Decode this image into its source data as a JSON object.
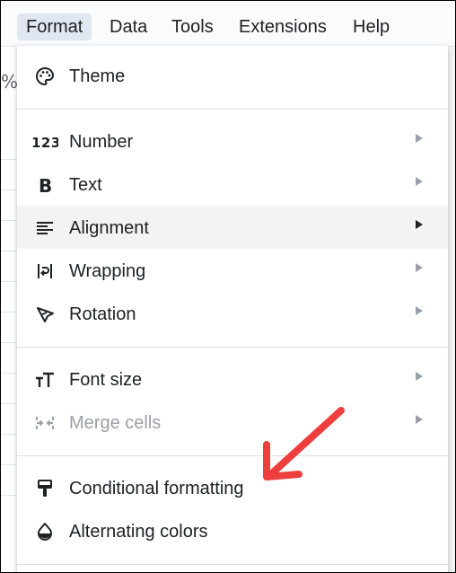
{
  "menubar": {
    "items": [
      {
        "label": "Format",
        "active": true
      },
      {
        "label": "Data"
      },
      {
        "label": "Tools"
      },
      {
        "label": "Extensions"
      },
      {
        "label": "Help"
      }
    ]
  },
  "background": {
    "cell_text": "%"
  },
  "format_menu": {
    "theme": {
      "label": "Theme",
      "icon": "palette-icon"
    },
    "number": {
      "label": "Number",
      "icon": "number-123-icon"
    },
    "text": {
      "label": "Text",
      "icon": "bold-icon"
    },
    "alignment": {
      "label": "Alignment",
      "icon": "align-left-icon",
      "highlighted": true
    },
    "wrapping": {
      "label": "Wrapping",
      "icon": "text-wrap-icon"
    },
    "rotation": {
      "label": "Rotation",
      "icon": "text-rotation-icon"
    },
    "font_size": {
      "label": "Font size",
      "icon": "font-size-icon"
    },
    "merge_cells": {
      "label": "Merge cells",
      "icon": "merge-cells-icon",
      "disabled": true
    },
    "conditional_formatting": {
      "label": "Conditional formatting",
      "icon": "paint-roller-icon"
    },
    "alternating_colors": {
      "label": "Alternating colors",
      "icon": "color-drop-icon"
    }
  },
  "colors": {
    "annotation_arrow": "#ef3e3e",
    "hover_row": "#f1f3f4",
    "active_menu": "#e1e7f0",
    "disabled_text": "#9aa0a6"
  }
}
